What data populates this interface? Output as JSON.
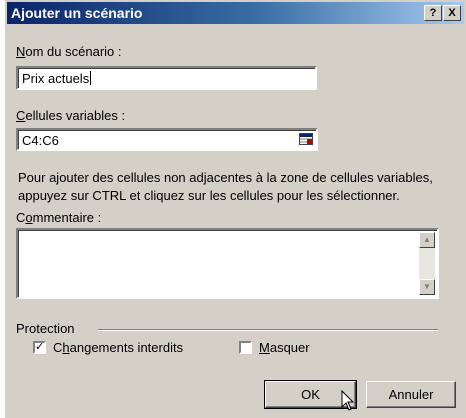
{
  "dialog": {
    "title": "Ajouter un scénario",
    "help_button": "?",
    "close_button": "X"
  },
  "scenario_name": {
    "label_first": "N",
    "label_rest": "om du scénario :",
    "value": "Prix actuels"
  },
  "changing_cells": {
    "label_first": "C",
    "label_rest": "ellules variables :",
    "value": "C4:C6"
  },
  "help_text": {
    "line1": "Pour ajouter des cellules non adjacentes à la zone de cellules variables,",
    "line2": "appuyez sur CTRL et cliquez sur les cellules pour les sélectionner."
  },
  "comment": {
    "label_pre": "C",
    "label_u": "o",
    "label_rest": "mmentaire :",
    "value": ""
  },
  "protection": {
    "group_label": "Protection",
    "prevent_changes_pre": "C",
    "prevent_changes_u": "h",
    "prevent_changes_rest": "angements interdits",
    "prevent_changes_checked": true,
    "hide_u": "M",
    "hide_rest": "asquer",
    "hide_checked": false
  },
  "buttons": {
    "ok": "OK",
    "cancel": "Annuler"
  }
}
